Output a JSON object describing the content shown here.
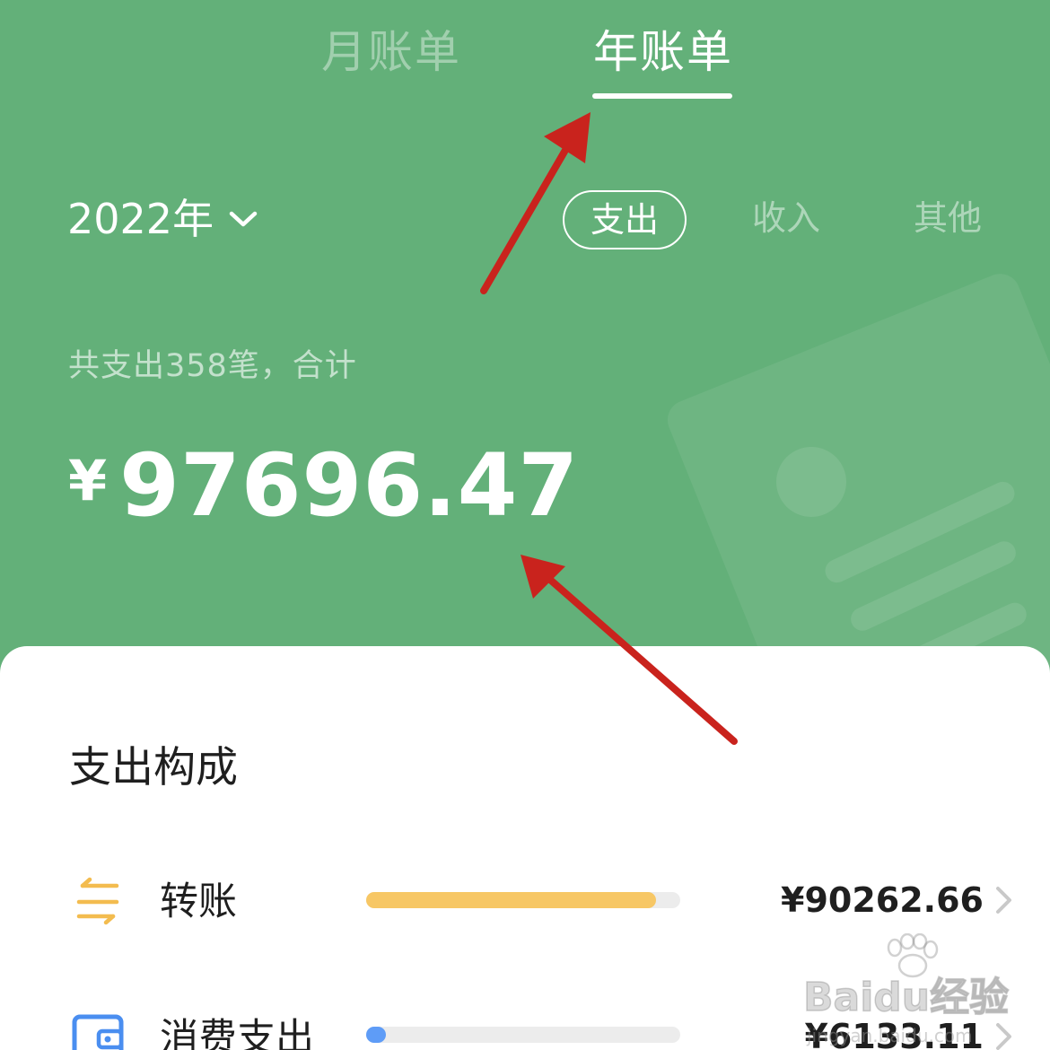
{
  "tabs": {
    "month": "月账单",
    "year": "年账单"
  },
  "year_picker": {
    "value": "2022年",
    "icon": "chevron-down-icon"
  },
  "type_filter": {
    "expense": "支出",
    "income": "收入",
    "other": "其他",
    "selected": "支出"
  },
  "summary": {
    "text": "共支出358笔，合计",
    "currency": "¥",
    "amount": "97696.47"
  },
  "breakdown": {
    "title": "支出构成",
    "items": [
      {
        "label": "转账",
        "amount": "¥90262.66",
        "share": 0.924,
        "color": "#f7c765",
        "icon": "transfer-arrows-icon"
      },
      {
        "label": "消费支出",
        "amount": "¥6133.11",
        "share": 0.063,
        "color": "#5e9cf7",
        "icon": "wallet-icon"
      }
    ]
  },
  "watermark": {
    "logo": "Baidu经验",
    "url": "jingyan.baidu.com"
  },
  "colors": {
    "header_green": "#63b079",
    "annotation_arrow": "#c9231d"
  }
}
